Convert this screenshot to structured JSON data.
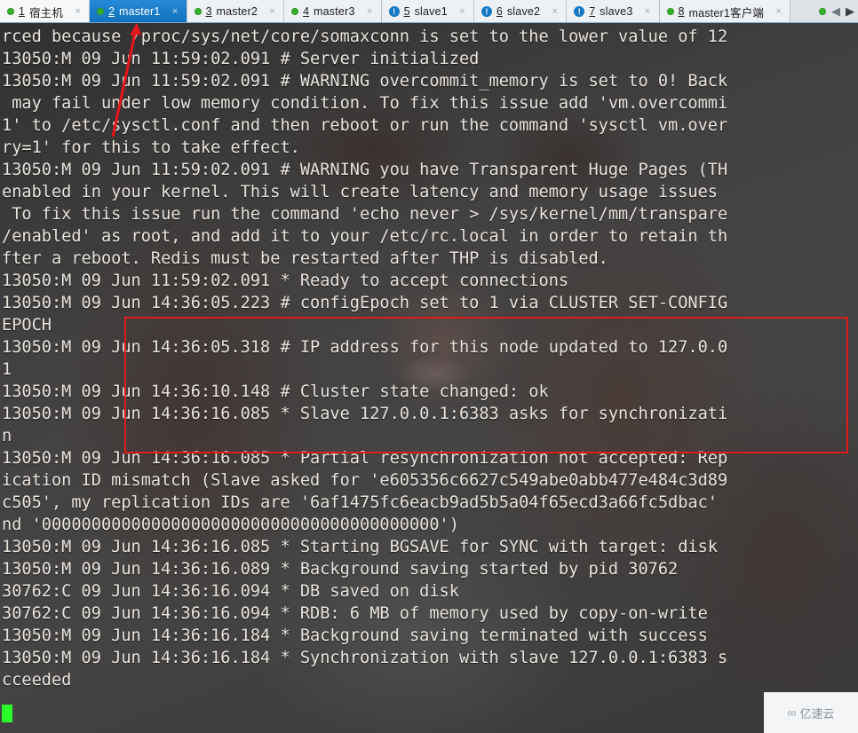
{
  "tabs": [
    {
      "num": "1",
      "label": "宿主机",
      "state": "ok",
      "active": false,
      "close": "×"
    },
    {
      "num": "2",
      "label": "master1",
      "state": "ok",
      "active": true,
      "close": "×"
    },
    {
      "num": "3",
      "label": "master2",
      "state": "ok",
      "active": false,
      "close": "×"
    },
    {
      "num": "4",
      "label": "master3",
      "state": "ok",
      "active": false,
      "close": "×"
    },
    {
      "num": "5",
      "label": "slave1",
      "state": "alert",
      "active": false,
      "close": "×"
    },
    {
      "num": "6",
      "label": "slave2",
      "state": "alert",
      "active": false,
      "close": "×"
    },
    {
      "num": "7",
      "label": "slave3",
      "state": "alert",
      "active": false,
      "close": "×"
    },
    {
      "num": "8",
      "label": "master1客户端",
      "state": "ok",
      "active": false,
      "close": "×"
    }
  ],
  "tab_nav": {
    "left_arrow": "◀",
    "right_arrow": "▶"
  },
  "terminal": {
    "lines": [
      "rced because /proc/sys/net/core/somaxconn is set to the lower value of 12",
      "13050:M 09 Jun 11:59:02.091 # Server initialized",
      "13050:M 09 Jun 11:59:02.091 # WARNING overcommit_memory is set to 0! Back",
      " may fail under low memory condition. To fix this issue add 'vm.overcommi",
      "1' to /etc/sysctl.conf and then reboot or run the command 'sysctl vm.over",
      "ry=1' for this to take effect.",
      "13050:M 09 Jun 11:59:02.091 # WARNING you have Transparent Huge Pages (TH",
      "enabled in your kernel. This will create latency and memory usage issues",
      " To fix this issue run the command 'echo never > /sys/kernel/mm/transpare",
      "/enabled' as root, and add it to your /etc/rc.local in order to retain th",
      "fter a reboot. Redis must be restarted after THP is disabled.",
      "13050:M 09 Jun 11:59:02.091 * Ready to accept connections",
      "13050:M 09 Jun 14:36:05.223 # configEpoch set to 1 via CLUSTER SET-CONFIG",
      "EPOCH",
      "13050:M 09 Jun 14:36:05.318 # IP address for this node updated to 127.0.0",
      "1",
      "13050:M 09 Jun 14:36:10.148 # Cluster state changed: ok",
      "13050:M 09 Jun 14:36:16.085 * Slave 127.0.0.1:6383 asks for synchronizati",
      "n",
      "13050:M 09 Jun 14:36:16.085 * Partial resynchronization not accepted: Rep",
      "ication ID mismatch (Slave asked for 'e605356c6627c549abe0abb477e484c3d89",
      "c505', my replication IDs are '6af1475fc6eacb9ad5b5a04f65ecd3a66fc5dbac'",
      "nd '0000000000000000000000000000000000000000')",
      "13050:M 09 Jun 14:36:16.085 * Starting BGSAVE for SYNC with target: disk",
      "13050:M 09 Jun 14:36:16.089 * Background saving started by pid 30762",
      "30762:C 09 Jun 14:36:16.094 * DB saved on disk",
      "30762:C 09 Jun 14:36:16.094 * RDB: 6 MB of memory used by copy-on-write",
      "13050:M 09 Jun 14:36:16.184 * Background saving terminated with success",
      "13050:M 09 Jun 14:36:16.184 * Synchronization with slave 127.0.0.1:6383 s",
      "cceeded"
    ]
  },
  "annotations": {
    "highlight_box_color": "#e01b1b",
    "arrow_color": "#e8161b",
    "arrow_target_tab": "2 master1"
  },
  "watermark": {
    "icon": "∞",
    "text": "亿速云"
  }
}
